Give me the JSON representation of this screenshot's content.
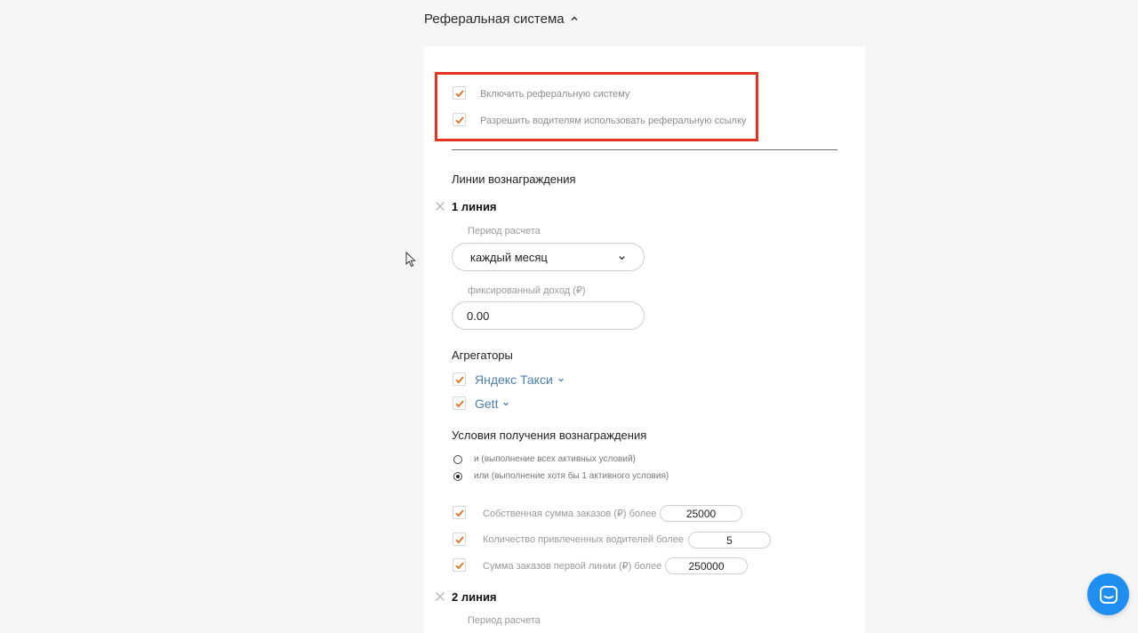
{
  "section": {
    "title": "Реферальная система",
    "expanded_icon": "chevron-up-icon"
  },
  "settings": {
    "enable_referral": {
      "label": "Включить реферальную систему",
      "checked": true
    },
    "allow_driver_link": {
      "label": "Разрешить водителям использовать реферальную ссылку",
      "checked": true
    }
  },
  "reward_lines": {
    "heading": "Линии вознаграждения"
  },
  "line1": {
    "title": "1 линия",
    "period_label": "Период расчета",
    "period_value": "каждый месяц",
    "income_label": "фиксированный доход (₽)",
    "income_value": "0.00",
    "aggregators_heading": "Агрегаторы",
    "aggregators": [
      {
        "label": "Яндекс Такси",
        "checked": true
      },
      {
        "label": "Gett",
        "checked": true
      }
    ],
    "conditions_heading": "Условия получения вознаграждения",
    "logic_options": [
      {
        "label": "и (выполнение всех активных условий)",
        "selected": false
      },
      {
        "label": "или (выполнение хотя бы 1 активного условия)",
        "selected": true
      }
    ],
    "conditions": [
      {
        "label": "Собственная сумма заказов (₽) более",
        "value": "25000",
        "checked": true
      },
      {
        "label": "Количество привлеченных водителей более",
        "value": "5",
        "checked": true
      },
      {
        "label": "Сумма заказов первой линии (₽) более",
        "value": "250000",
        "checked": true
      }
    ]
  },
  "line2": {
    "title": "2 линия",
    "period_label": "Период расчета"
  },
  "colors": {
    "accent_check": "#e0731f",
    "highlight_box": "#e8321e",
    "link": "#4a7fb3",
    "chat": "#1f8ef1"
  }
}
